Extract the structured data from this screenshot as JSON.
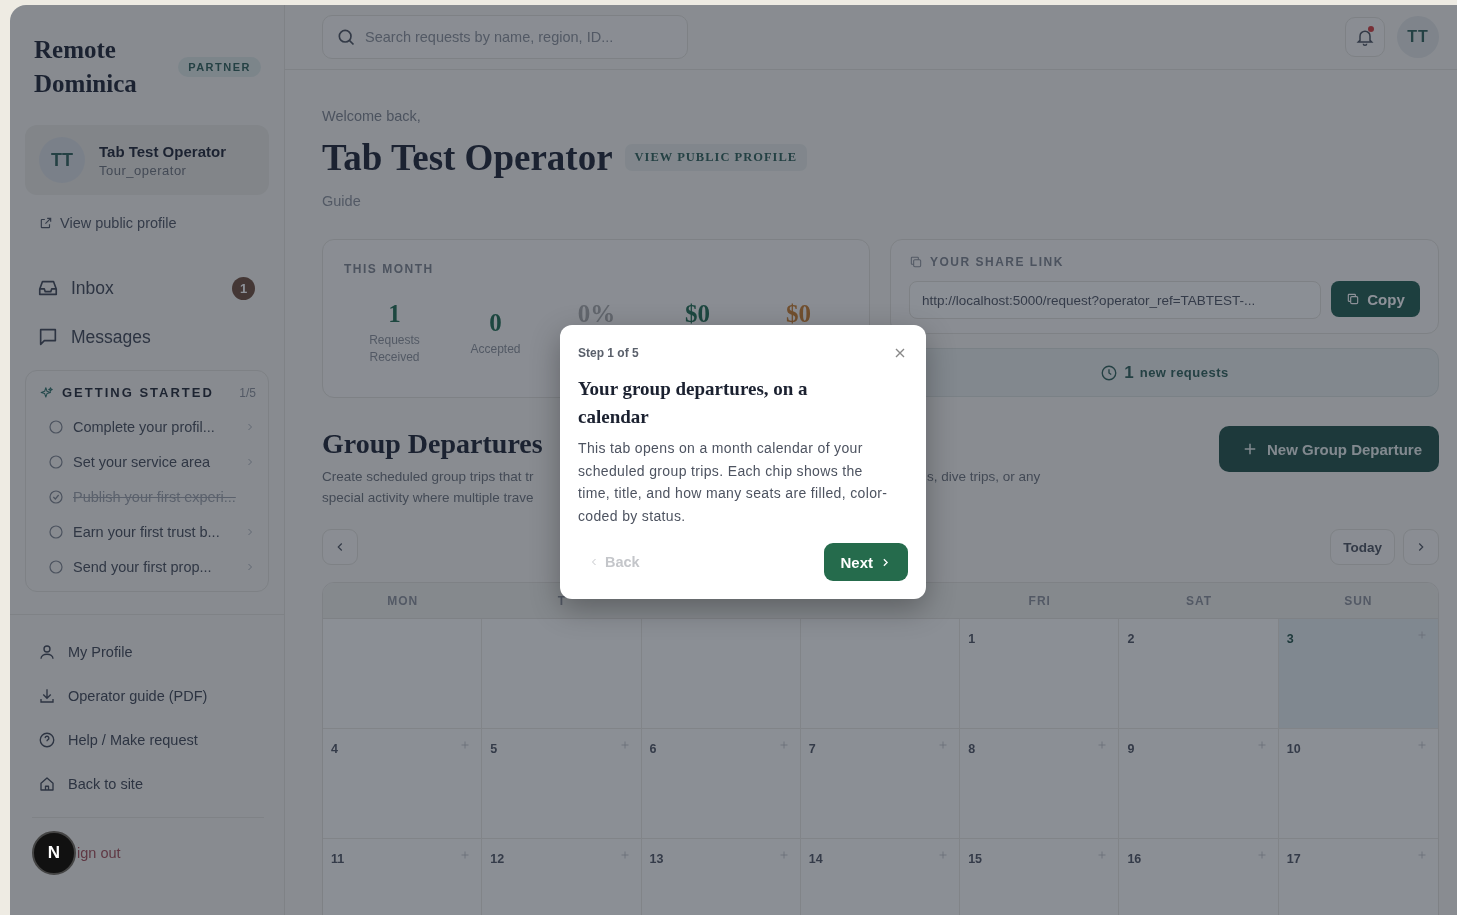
{
  "sidebar": {
    "brand": "Remote Dominica",
    "badge": "PARTNER",
    "user": {
      "initials": "TT",
      "name": "Tab Test Operator",
      "role": "Tour_operator"
    },
    "public_link": "View public profile",
    "nav": [
      {
        "label": "Inbox",
        "count": "1"
      },
      {
        "label": "Messages"
      }
    ],
    "getting_started": {
      "title": "GETTING STARTED",
      "progress": "1/5",
      "items": [
        {
          "label": "Complete your profil...",
          "done": false
        },
        {
          "label": "Set your service area",
          "done": false
        },
        {
          "label": "Publish your first experi...",
          "done": true
        },
        {
          "label": "Earn your first trust b...",
          "done": false
        },
        {
          "label": "Send your first prop...",
          "done": false
        }
      ]
    },
    "footer_links": [
      {
        "label": "My Profile"
      },
      {
        "label": "Operator guide (PDF)"
      },
      {
        "label": "Help / Make request"
      },
      {
        "label": "Back to site"
      }
    ],
    "sign_out": "ign out",
    "dev_badge": "N"
  },
  "topbar": {
    "search": {
      "placeholder": "Search requests by name, region, ID..."
    },
    "notification_dot": true,
    "avatar": "TT"
  },
  "header": {
    "greeting": "Welcome back,",
    "name": "Tab Test Operator",
    "profile_link": "VIEW PUBLIC PROFILE",
    "role": "Guide"
  },
  "stats": {
    "title": "THIS MONTH",
    "items": [
      {
        "value": "1",
        "label": "Requests Received"
      },
      {
        "value": "0",
        "label": "Accepted"
      },
      {
        "value": "0%"
      },
      {
        "value": "$0"
      },
      {
        "value": "$0"
      }
    ]
  },
  "share": {
    "title": "YOUR SHARE LINK",
    "url": "http://localhost:5000/request?operator_ref=TABTEST-...",
    "button": "Copy"
  },
  "new_requests": {
    "count": "1",
    "label": "new requests"
  },
  "departures": {
    "title": "Group Departures",
    "description_lines": [
      {
        "left": "Create scheduled group trips that tr",
        "right": "s, dive trips, or any"
      },
      {
        "left": "special activity where multiple trave"
      }
    ],
    "new_button": "New Group Departure",
    "today_button": "Today"
  },
  "calendar": {
    "weekdays": [
      "MON",
      "T",
      "FRI",
      "SAT",
      "SUN"
    ],
    "weeks": [
      [
        {
          "day": "1",
          "add": false,
          "today": false
        },
        {
          "day": "2",
          "add": false,
          "today": false
        },
        {
          "day": "3",
          "add": true,
          "today": true
        }
      ],
      [
        {
          "day": "4",
          "add": true,
          "today": false
        },
        {
          "day": "5",
          "add": true,
          "today": false
        },
        {
          "day": "6",
          "add": true,
          "today": false
        },
        {
          "day": "7",
          "add": true,
          "today": false
        },
        {
          "day": "8",
          "add": true,
          "today": false
        },
        {
          "day": "9",
          "add": true,
          "today": false
        },
        {
          "day": "10",
          "add": true,
          "today": false
        }
      ],
      [
        {
          "day": "11",
          "add": true,
          "today": false
        },
        {
          "day": "12",
          "add": true,
          "today": false
        },
        {
          "day": "13",
          "add": true,
          "today": false
        },
        {
          "day": "14",
          "add": true,
          "today": false
        },
        {
          "day": "15",
          "add": true,
          "today": false
        },
        {
          "day": "16",
          "add": true,
          "today": false
        },
        {
          "day": "17",
          "add": true,
          "today": false
        }
      ]
    ]
  },
  "tour": {
    "step": "Step 1 of 5",
    "title": "Your group departures, on a calendar",
    "body": "This tab opens on a month calendar of your scheduled group trips. Each chip shows the time, title, and how many seats are filled, color-coded by status.",
    "back": "Back",
    "back_disabled": true,
    "next": "Next"
  }
}
